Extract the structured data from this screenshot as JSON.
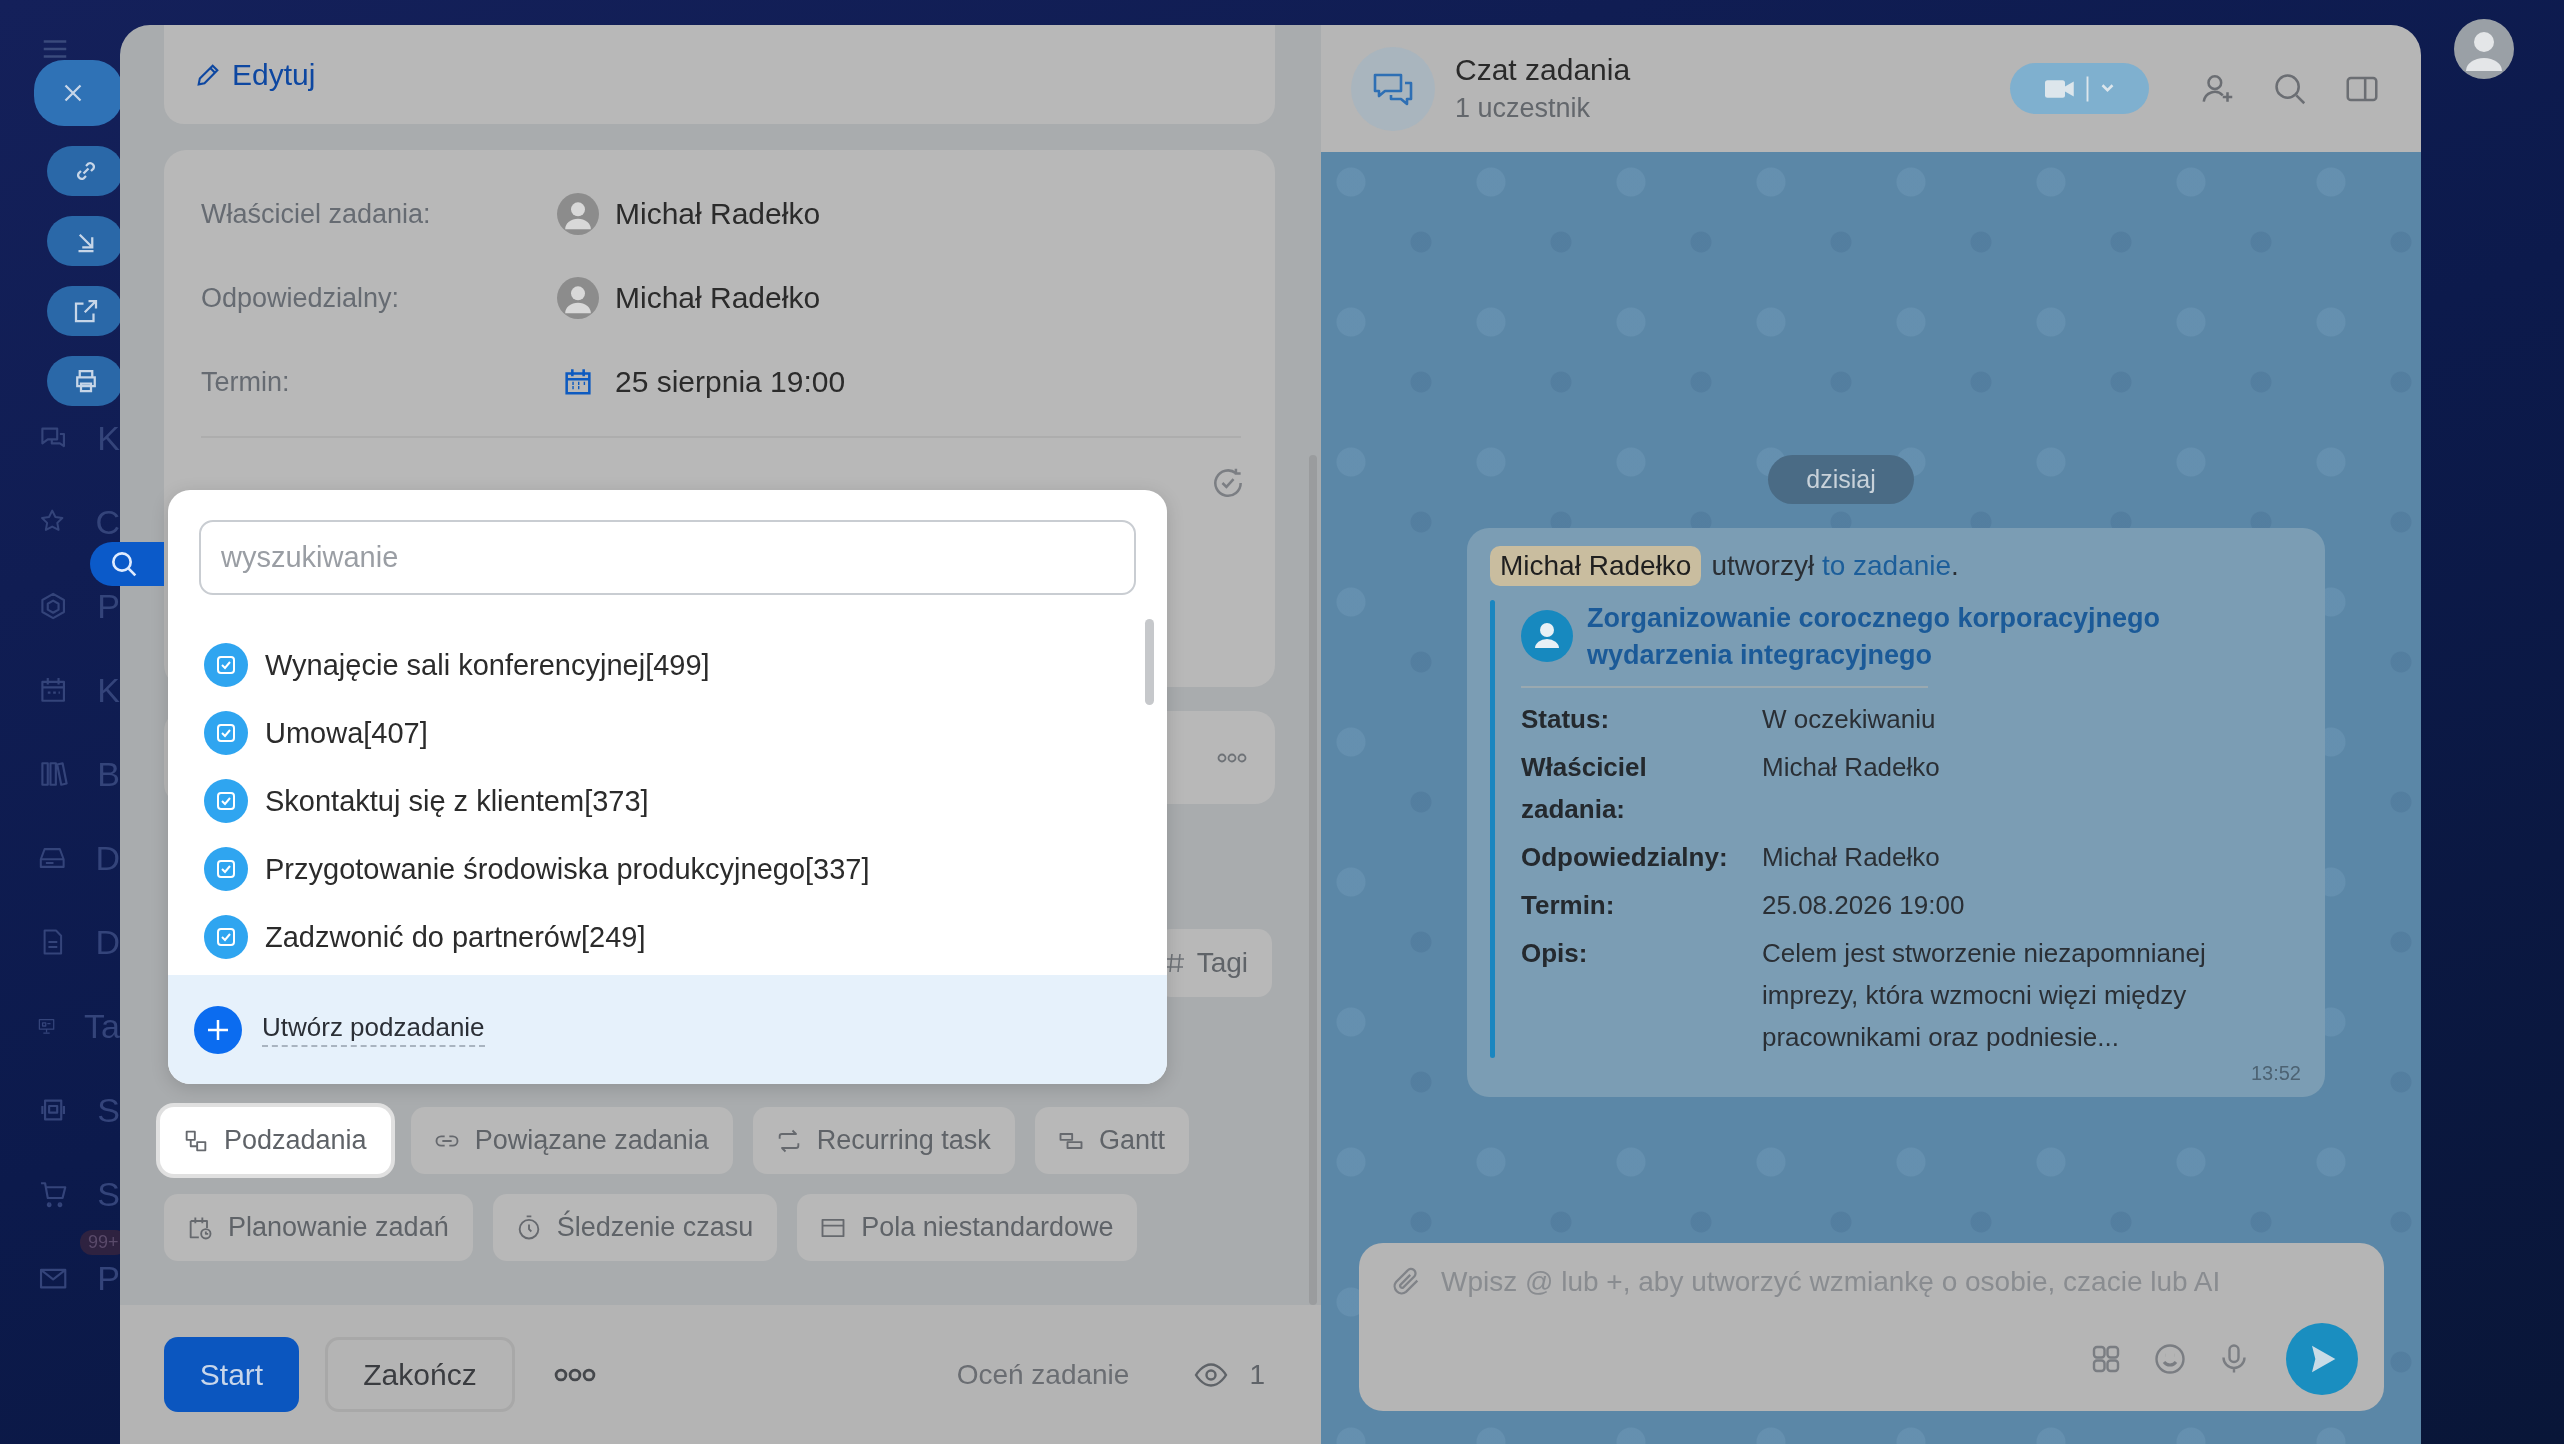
{
  "sidebar": {
    "items": [
      {
        "label": "K"
      },
      {
        "label": "C"
      },
      {
        "label": "P"
      },
      {
        "label": "K"
      },
      {
        "label": "B"
      },
      {
        "label": "D"
      },
      {
        "label": "D"
      },
      {
        "label": "Ta"
      },
      {
        "label": "S"
      },
      {
        "label": "S"
      },
      {
        "label": "P",
        "badge": "99+"
      }
    ]
  },
  "task": {
    "edit_label": "Edytuj",
    "fields": [
      {
        "label": "Właściciel zadania:",
        "value": "Michał Radełko",
        "kind": "person"
      },
      {
        "label": "Odpowiedzialny:",
        "value": "Michał Radełko",
        "kind": "person"
      },
      {
        "label": "Termin:",
        "value": "25 sierpnia 19:00",
        "kind": "date"
      }
    ],
    "tags_label": "Tagi",
    "features": [
      {
        "label": "Podzadania",
        "selected": true
      },
      {
        "label": "Powiązane zadania",
        "selected": false
      },
      {
        "label": "Recurring task",
        "selected": false
      },
      {
        "label": "Gantt",
        "selected": false
      },
      {
        "label": "Planowanie zadań",
        "selected": false
      },
      {
        "label": "Śledzenie czasu",
        "selected": false
      },
      {
        "label": "Pola niestandardowe",
        "selected": false
      }
    ],
    "footer": {
      "start": "Start",
      "finish": "Zakończ",
      "rate": "Oceń zadanie",
      "views": "1"
    }
  },
  "subtask_picker": {
    "search": {
      "placeholder": "wyszukiwanie"
    },
    "items": [
      {
        "label": "Wynajęcie sali konferencyjnej[499]"
      },
      {
        "label": "Umowa[407]"
      },
      {
        "label": "Skontaktuj się z klientem[373]"
      },
      {
        "label": "Przygotowanie środowiska produkcyjnego[337]"
      },
      {
        "label": "Zadzwonić do partnerów[249]"
      }
    ],
    "create_label": "Utwórz podzadanie"
  },
  "chat": {
    "title": "Czat zadania",
    "subtitle": "1 uczestnik",
    "date_divider": "dzisiaj",
    "message": {
      "author": "Michał Radełko",
      "action": "utworzył",
      "link": "to zadanie",
      "after_link": ".",
      "task_title": "Zorganizowanie corocznego korporacyjnego wydarzenia integracyjnego",
      "fields": [
        {
          "label": "Status:",
          "value": "W oczekiwaniu"
        },
        {
          "label": "Właściciel zadania:",
          "value": "Michał Radełko"
        },
        {
          "label": "Odpowiedzialny:",
          "value": "Michał Radełko"
        },
        {
          "label": "Termin:",
          "value": "25.08.2026 19:00"
        },
        {
          "label": "Opis:",
          "value": "Celem jest stworzenie niezapomnianej imprezy, która wzmocni więzi między pracownikami oraz podniesie..."
        }
      ],
      "time": "13:52"
    },
    "composer": {
      "placeholder": "Wpisz @ lub +, aby utworzyć wzmiankę o osobie, czacie lub AI"
    }
  }
}
